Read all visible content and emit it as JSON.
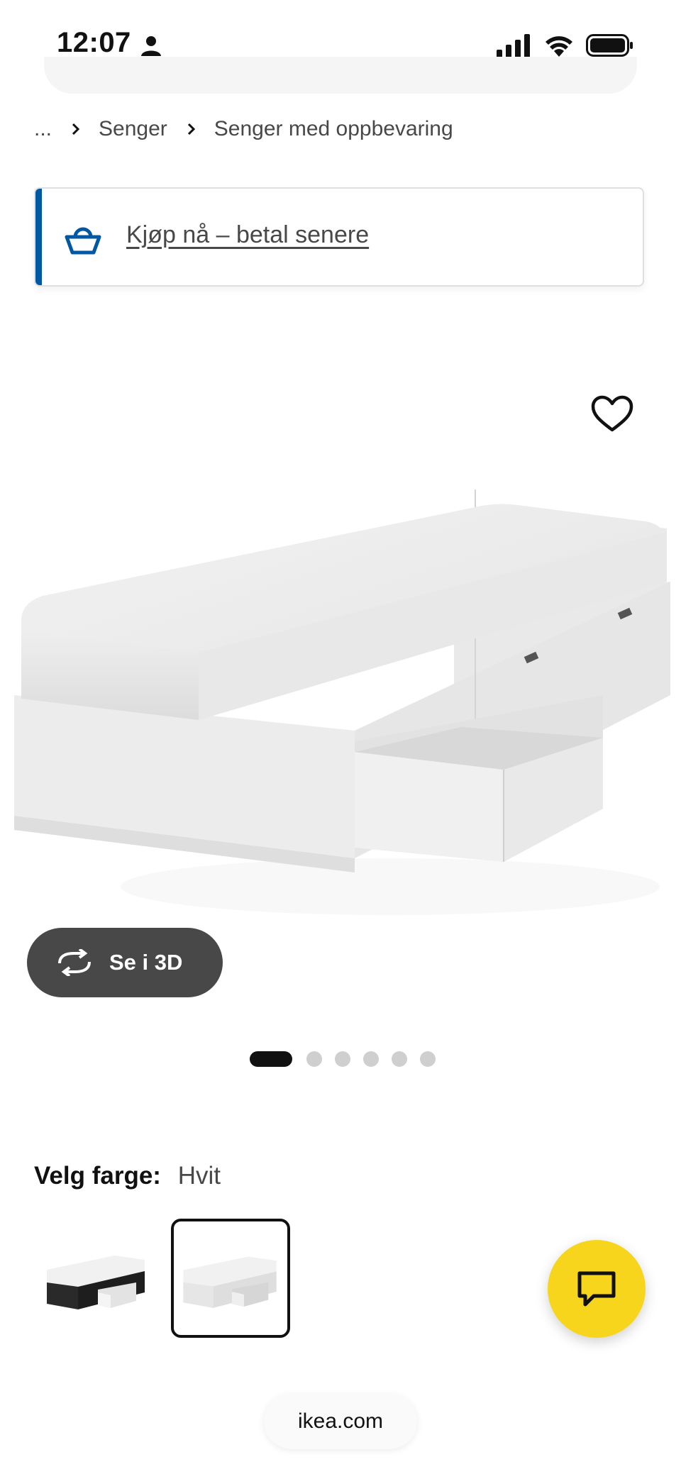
{
  "status_bar": {
    "time": "12:07"
  },
  "breadcrumb": {
    "items": [
      "...",
      "Senger",
      "Senger med oppbevaring"
    ]
  },
  "promo_banner": {
    "link_text": "Kjøp nå – betal senere",
    "icon": "basket-icon",
    "accent_color": "#0058a3"
  },
  "product": {
    "view_3d_label": "Se i 3D",
    "carousel": {
      "total": 6,
      "active_index": 0
    }
  },
  "color_selector": {
    "label": "Velg farge:",
    "selected_value": "Hvit"
  },
  "chat": {
    "icon": "chat-bubble-icon",
    "color": "#f7d51d"
  },
  "browser": {
    "url": "ikea.com"
  }
}
